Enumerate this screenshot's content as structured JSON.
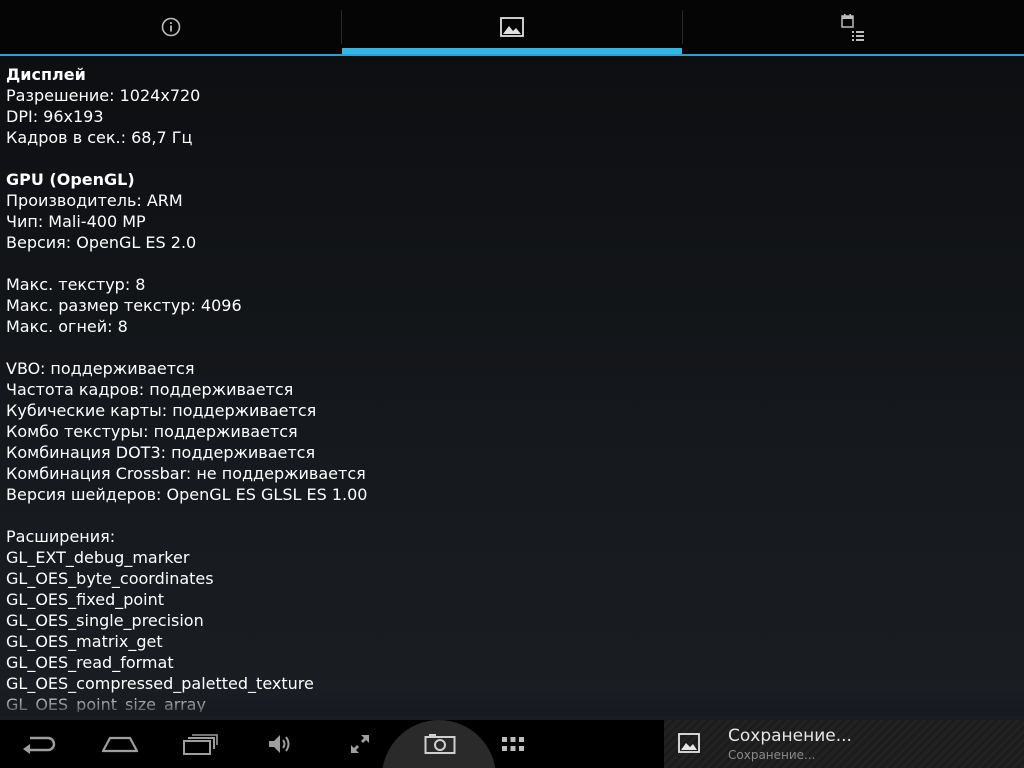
{
  "tabs": [
    {
      "icon": "info-icon",
      "active": false
    },
    {
      "icon": "image-icon",
      "active": true
    },
    {
      "icon": "calendar-list-icon",
      "active": false
    }
  ],
  "accent_color": "#33b5e5",
  "content": {
    "display": {
      "heading": "Дисплей",
      "resolution": "Разрешение: 1024x720",
      "dpi": "DPI: 96x193",
      "fps": "Кадров в сек.: 68,7 Гц"
    },
    "gpu": {
      "heading": "GPU (OpenGL)",
      "vendor": "Производитель: ARM",
      "chip": "Чип: Mali-400 MP",
      "version": "Версия: OpenGL ES 2.0"
    },
    "limits": {
      "max_textures": "Макс. текстур: 8",
      "max_texture_size": "Макс. размер текстур: 4096",
      "max_lights": "Макс. огней: 8"
    },
    "features": [
      "VBO: поддерживается",
      "Частота кадров: поддерживается",
      "Кубические карты: поддерживается",
      "Комбо текстуры: поддерживается",
      "Комбинация DOT3: поддерживается",
      "Комбинация Crossbar: не поддерживается",
      "Версия шейдеров: OpenGL ES GLSL ES 1.00"
    ],
    "extensions_heading": "Расширения:",
    "extensions": [
      "GL_EXT_debug_marker",
      "GL_OES_byte_coordinates",
      "GL_OES_fixed_point",
      "GL_OES_single_precision",
      "GL_OES_matrix_get",
      "GL_OES_read_format",
      "GL_OES_compressed_paletted_texture",
      "GL_OES_point_size_array"
    ]
  },
  "navbar": {
    "buttons": [
      "back-icon",
      "home-icon",
      "recent-apps-icon",
      "volume-icon",
      "expand-icon",
      "screenshot-camera-icon",
      "app-grid-icon"
    ]
  },
  "notification": {
    "title": "Сохранение...",
    "subtitle": "Сохранение..."
  }
}
